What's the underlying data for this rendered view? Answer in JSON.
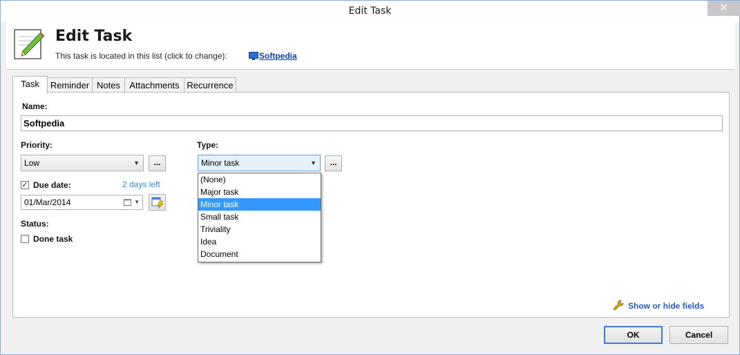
{
  "window": {
    "title": "Edit Task",
    "close_glyph": "✕"
  },
  "header": {
    "title": "Edit Task",
    "location_text": "This task is located in this list (click to change):",
    "list_link": "Softpedia",
    "icon": "pencil-icon"
  },
  "tabs": [
    {
      "label": "Task",
      "active": true
    },
    {
      "label": "Reminder",
      "active": false
    },
    {
      "label": "Notes",
      "active": false
    },
    {
      "label": "Attachments",
      "active": false
    },
    {
      "label": "Recurrence",
      "active": false
    }
  ],
  "form": {
    "name_label": "Name:",
    "name_value": "Softpedia",
    "priority_label": "Priority:",
    "priority_value": "Low",
    "type_label": "Type:",
    "type_value": "Minor task",
    "ellipsis": "...",
    "due_label": "Due date:",
    "due_checked": true,
    "days_left": "2 days left",
    "due_value": "01/Mar/2014",
    "status_label": "Status:",
    "done_label": "Done task",
    "done_checked": false,
    "show_hide": "Show or hide fields"
  },
  "type_options": [
    "(None)",
    "Major task",
    "Minor task",
    "Small task",
    "Triviality",
    "Idea",
    "Document"
  ],
  "type_selected_index": 2,
  "buttons": {
    "ok": "OK",
    "cancel": "Cancel"
  },
  "colors": {
    "accent": "#3399ff",
    "link": "#0b3fb5",
    "days_left": "#2a8be0"
  }
}
